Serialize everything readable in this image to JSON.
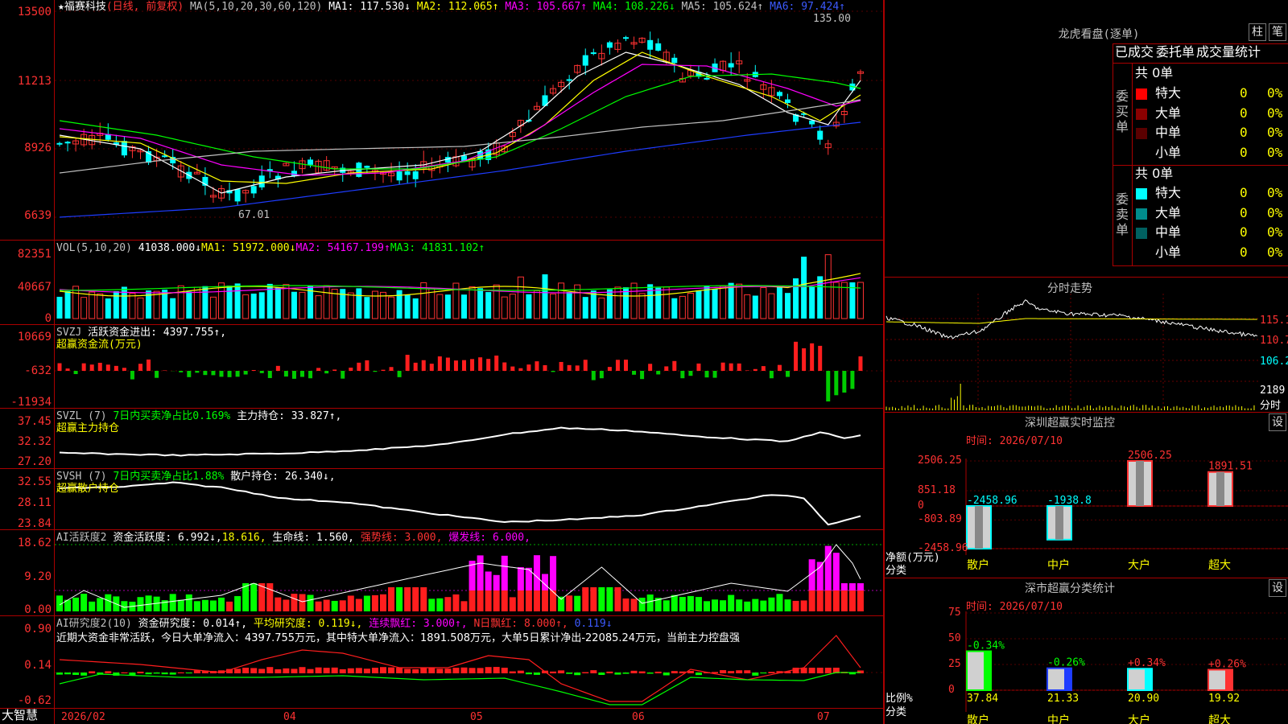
{
  "window": {
    "app_logo": "大智慧",
    "stock": "福赛科技",
    "mode": "(日线, 前复权)",
    "date_start": "2026/02"
  },
  "main": {
    "header": {
      "star": "★",
      "ma_title": "MA(5,10,20,30,60,120)",
      "ma1": "MA1: 117.530↓",
      "ma2": "MA2: 112.065↑",
      "ma3": "MA3: 105.667↑",
      "ma4": "MA4: 108.226↓",
      "ma5": "MA5: 105.624↑",
      "ma6": "MA6: 97.424↑"
    },
    "y_labels": [
      "13500",
      "11213",
      "8926",
      "6639"
    ],
    "high_label": "135.00",
    "low_label": "67.01"
  },
  "vol": {
    "title": "VOL(5,10,20)",
    "v": "41038.000↓",
    "ma1": "MA1: 51972.000↓",
    "ma2": "MA2: 54167.199↑",
    "ma3": "MA3: 41831.102↑",
    "y_labels": [
      "82351",
      "40667",
      "0"
    ]
  },
  "svzj": {
    "title": "SVZJ",
    "desc": "活跃资金进出: 4397.755↑,",
    "sub": "超赢资金流(万元)",
    "y_labels": [
      "10669",
      "-632",
      "-11934"
    ]
  },
  "svzl": {
    "title": "SVZL (7)",
    "desc1": "7日内买卖净占比0.169%",
    "desc2": "主力持仓: 33.827↑,",
    "sub": "超赢主力持仓",
    "y_labels": [
      "37.45",
      "32.32",
      "27.20"
    ]
  },
  "svsh": {
    "title": "SVSH (7)",
    "desc1": "7日内买卖净占比1.88%",
    "desc2": "散户持仓: 26.340↓,",
    "sub": "超赢散户持仓",
    "y_labels": [
      "32.55",
      "28.11",
      "23.84"
    ]
  },
  "ai1": {
    "title": "AI活跃度2",
    "a": "资金活跃度: 6.992↓,",
    "b": "18.616,",
    "c": "生命线: 1.560,",
    "d": "强势线: 3.000,",
    "e": "爆发线: 6.000,",
    "y_labels": [
      "18.62",
      "9.20",
      "0.00"
    ]
  },
  "ai2": {
    "title": "AI研究度2(10)",
    "a": "资金研究度: 0.014↑,",
    "b": "平均研究度: 0.119↓,",
    "c": "连续飘红: 3.000↑,",
    "d": "N日飘红: 8.000↑,",
    "e": "0.119↓",
    "summary": "近期大资金非常活跃，今日大单净流入：4397.755万元，其中特大单净流入：1891.508万元，大单5日累计净出-22085.24万元，当前主力控盘强",
    "y_labels": [
      "0.90",
      "0.14",
      "-0.62"
    ]
  },
  "x_labels": [
    "04",
    "05",
    "06",
    "07"
  ],
  "right": {
    "lhb_title": "龙虎看盘(逐单)",
    "btn1": "柱",
    "btn2": "笔",
    "tabs": [
      "已成交",
      "委托单",
      "成交量统计"
    ],
    "buy": {
      "label": "委买单",
      "total": "共 0单",
      "rows": [
        {
          "name": "特大",
          "n": "0",
          "p": "0%"
        },
        {
          "name": "大单",
          "n": "0",
          "p": "0%"
        },
        {
          "name": "中单",
          "n": "0",
          "p": "0%"
        },
        {
          "name": "小单",
          "n": "0",
          "p": "0%"
        }
      ]
    },
    "sell": {
      "label": "委卖单",
      "total": "共 0单",
      "rows": [
        {
          "name": "特大",
          "n": "0",
          "p": "0%"
        },
        {
          "name": "大单",
          "n": "0",
          "p": "0%"
        },
        {
          "name": "中单",
          "n": "0",
          "p": "0%"
        },
        {
          "name": "小单",
          "n": "0",
          "p": "0%"
        }
      ]
    },
    "intraday": {
      "title": "分时走势",
      "labels": [
        "115.1",
        "110.7",
        "106.2",
        "2189",
        "分时"
      ]
    },
    "sz_monitor": {
      "title": "深圳超赢实时监控",
      "btn": "设",
      "time": "时间: 2026/07/10",
      "y_labels": [
        "2506.25",
        "851.18",
        "0",
        "-803.89",
        "-2458.96"
      ],
      "axis_title": [
        "净额(万元)",
        "分类"
      ],
      "chart_data": {
        "type": "bar",
        "categories": [
          "散户",
          "中户",
          "大户",
          "超大"
        ],
        "values": [
          -2458.96,
          -1938.8,
          2506.25,
          1891.51
        ],
        "value_labels": [
          "-2458.96",
          "-1938.8",
          "2506.25",
          "1891.51"
        ],
        "ylim": [
          -2458.96,
          2506.25
        ]
      }
    },
    "sz_classify": {
      "title": "深市超赢分类统计",
      "btn": "设",
      "time": "时间: 2026/07/10",
      "y_labels": [
        "75",
        "50",
        "25",
        "0"
      ],
      "axis_title": [
        "比例%",
        "分类"
      ],
      "chart_data": {
        "type": "bar",
        "categories": [
          "散户",
          "中户",
          "大户",
          "超大"
        ],
        "values": [
          37.84,
          21.33,
          20.9,
          19.92
        ],
        "changes": [
          "-0.34%",
          "-0.26%",
          "+0.34%",
          "+0.26%"
        ],
        "ylim": [
          0,
          75
        ]
      }
    }
  },
  "colors": {
    "up": "#ff3232",
    "down": "#00ffff",
    "vol_down": "#00ffff",
    "green": "#00ff00",
    "magenta": "#ff00ff",
    "yellow": "#ffff00",
    "blue": "#1e3cff",
    "border": "#aa0000"
  }
}
